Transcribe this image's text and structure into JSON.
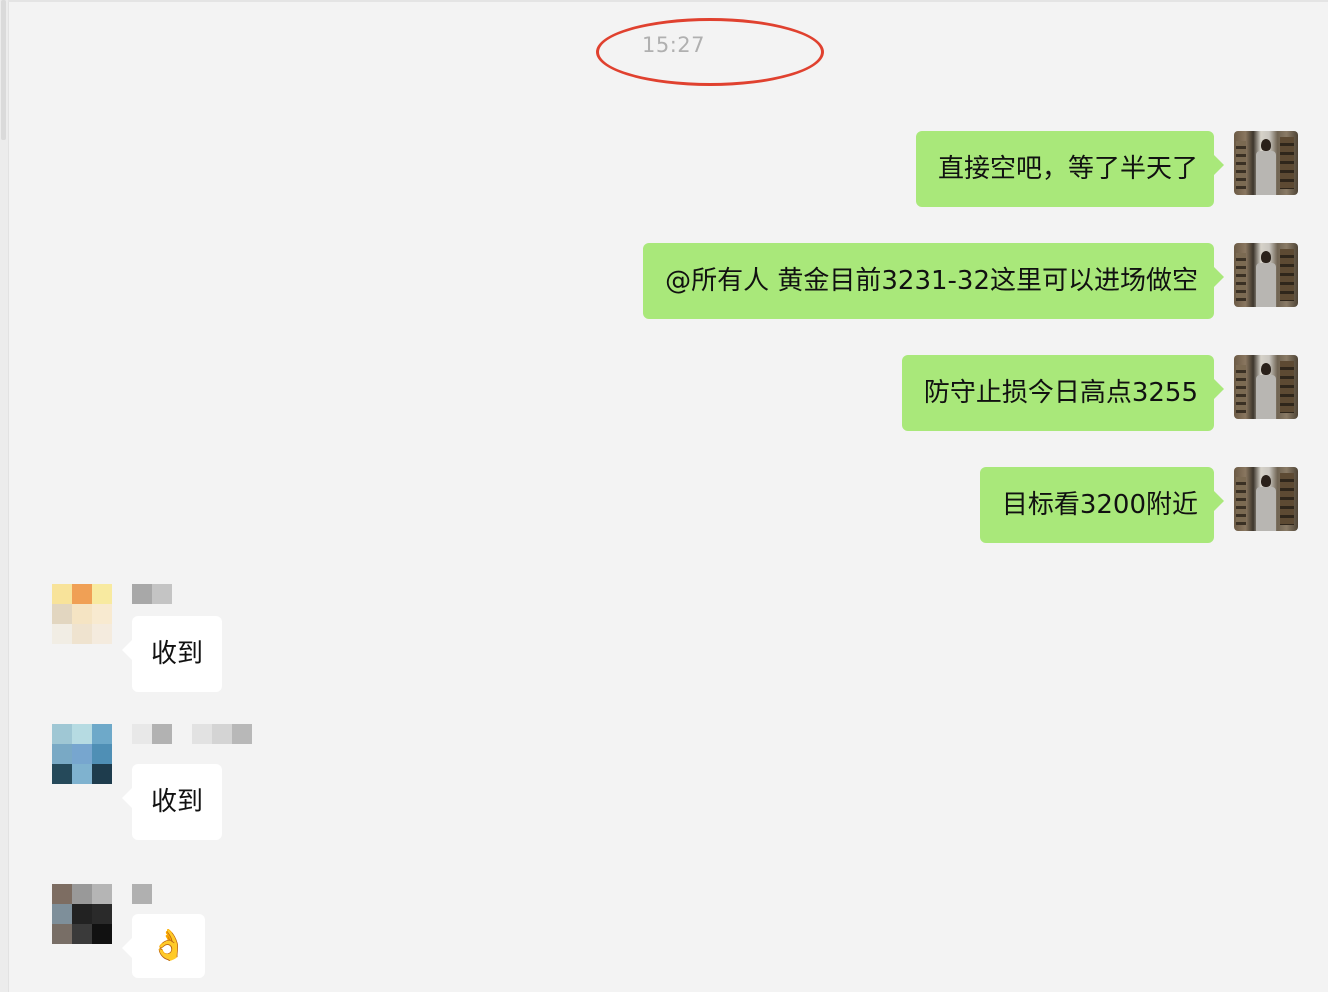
{
  "chat": {
    "timestamp": "15:27",
    "outgoing": [
      {
        "text": "直接空吧，等了半天了"
      },
      {
        "text": "@所有人 黄金目前3231-32这里可以进场做空"
      },
      {
        "text": "防守止损今日高点3255"
      },
      {
        "text": "目标看3200附近"
      }
    ],
    "incoming": [
      {
        "text": "收到"
      },
      {
        "text": "收到"
      },
      {
        "text": "👌"
      }
    ]
  },
  "colors": {
    "background": "#f3f3f3",
    "outgoing_bubble": "#a9e87a",
    "incoming_bubble": "#ffffff",
    "annotation_circle": "#e0412f"
  },
  "icons": {
    "self_avatar": "user-photo-avatar",
    "sender_avatars": "pixelated-avatar"
  }
}
